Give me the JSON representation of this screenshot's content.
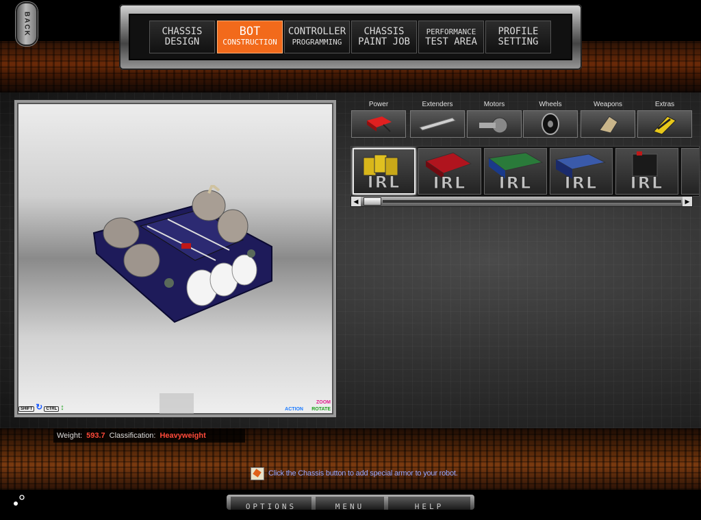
{
  "back": {
    "label": "BACK"
  },
  "nav": {
    "tabs": [
      {
        "line1": "CHASSIS",
        "line2": "DESIGN"
      },
      {
        "line1": "BOT",
        "line2": "CONSTRUCTION"
      },
      {
        "line1": "CONTROLLER",
        "line2": "PROGRAMMING"
      },
      {
        "line1": "CHASSIS",
        "line2": "PAINT JOB"
      },
      {
        "line1": "PERFORMANCE",
        "line2": "TEST AREA"
      },
      {
        "line1": "PROFILE",
        "line2": "SETTING"
      }
    ],
    "active_tab": "BOT CONSTRUCTION",
    "active_color": "#f26a1b"
  },
  "viewport": {
    "hints": {
      "shift": "SHIFT",
      "ctrl": "CTRL",
      "action": "ACTION",
      "zoom": "ZOOM",
      "rotate": "ROTATE"
    }
  },
  "categories": [
    {
      "label": "Power",
      "icon": "battery-icon"
    },
    {
      "label": "Extenders",
      "icon": "extender-bar-icon"
    },
    {
      "label": "Motors",
      "icon": "motor-icon"
    },
    {
      "label": "Wheels",
      "icon": "wheel-icon"
    },
    {
      "label": "Weapons",
      "icon": "weapon-icon"
    },
    {
      "label": "Extras",
      "icon": "extras-icon"
    }
  ],
  "parts": [
    {
      "label": "IRL",
      "icon": "battery-pack-yellow-icon",
      "color": "#d8b61a"
    },
    {
      "label": "IRL",
      "icon": "battery-red-icon",
      "color": "#b0141e"
    },
    {
      "label": "IRL",
      "icon": "battery-green-icon",
      "color": "#2a7a3a"
    },
    {
      "label": "IRL",
      "icon": "battery-blue-icon",
      "color": "#2a4a9a"
    },
    {
      "label": "IRL",
      "icon": "battery-black-icon",
      "color": "#1a1a1a"
    }
  ],
  "status": {
    "weight_label": "Weight:",
    "weight_value": "593.7",
    "class_label": "Classification:",
    "class_value": "Heavyweight"
  },
  "tip": {
    "text": "Click the Chassis button to add special armor to your robot."
  },
  "bottom": {
    "options": "OPTIONS",
    "menu": "MENU",
    "help": "HELP"
  }
}
